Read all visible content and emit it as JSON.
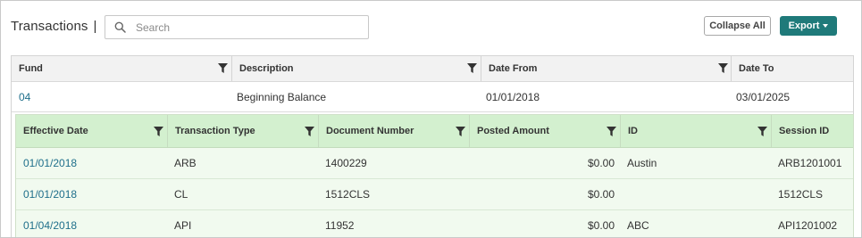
{
  "header": {
    "title": "Transactions",
    "separator": "|",
    "search_placeholder": "Search",
    "collapse_all_label": "Collapse All",
    "export_label": "Export"
  },
  "outer_table": {
    "columns": [
      "Fund",
      "Description",
      "Date From",
      "Date To"
    ],
    "rows": [
      {
        "fund": "04",
        "description": "Beginning Balance",
        "date_from": "01/01/2018",
        "date_to": "03/01/2025"
      }
    ]
  },
  "inner_table": {
    "columns": [
      "Effective Date",
      "Transaction Type",
      "Document Number",
      "Posted Amount",
      "ID",
      "Session ID"
    ],
    "rows": [
      {
        "effective_date": "01/01/2018",
        "transaction_type": "ARB",
        "document_number": "1400229",
        "posted_amount": "$0.00",
        "id": "Austin",
        "session_id": "ARB1201001"
      },
      {
        "effective_date": "01/01/2018",
        "transaction_type": "CL",
        "document_number": "1512CLS",
        "posted_amount": "$0.00",
        "id": "",
        "session_id": "1512CLS"
      },
      {
        "effective_date": "01/04/2018",
        "transaction_type": "API",
        "document_number": "11952",
        "posted_amount": "$0.00",
        "id": "ABC",
        "session_id": "API1201002"
      }
    ]
  },
  "icons": {
    "search": "search-icon",
    "filter": "filter-icon",
    "caret": "caret-down-icon"
  },
  "colors": {
    "accent": "#1f7a7a",
    "link": "#1f6f8b",
    "nested_header_bg": "#d3f0cf",
    "nested_row_bg": "#f1faef"
  }
}
